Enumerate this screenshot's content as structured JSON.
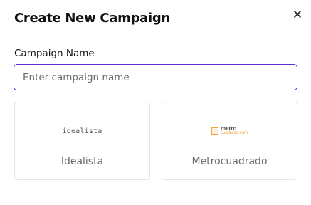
{
  "dialog": {
    "title": "Create New Campaign",
    "close_icon": "close-icon"
  },
  "form": {
    "campaign_name": {
      "label": "Campaign Name",
      "value": "",
      "placeholder": "Enter campaign name"
    }
  },
  "providers": [
    {
      "label": "Idealista",
      "logo_text": "idealista",
      "logo_icon": "idealista-logo"
    },
    {
      "label": "Metrocuadrado",
      "logo_top": "metro",
      "logo_bottom": "cuadrado.com",
      "logo_icon": "metrocuadrado-logo"
    }
  ],
  "colors": {
    "accent_border": "#5b2bd6",
    "metro_orange": "#f0a540",
    "card_border": "#e6e6e6",
    "muted_text": "#6a6a6a"
  }
}
